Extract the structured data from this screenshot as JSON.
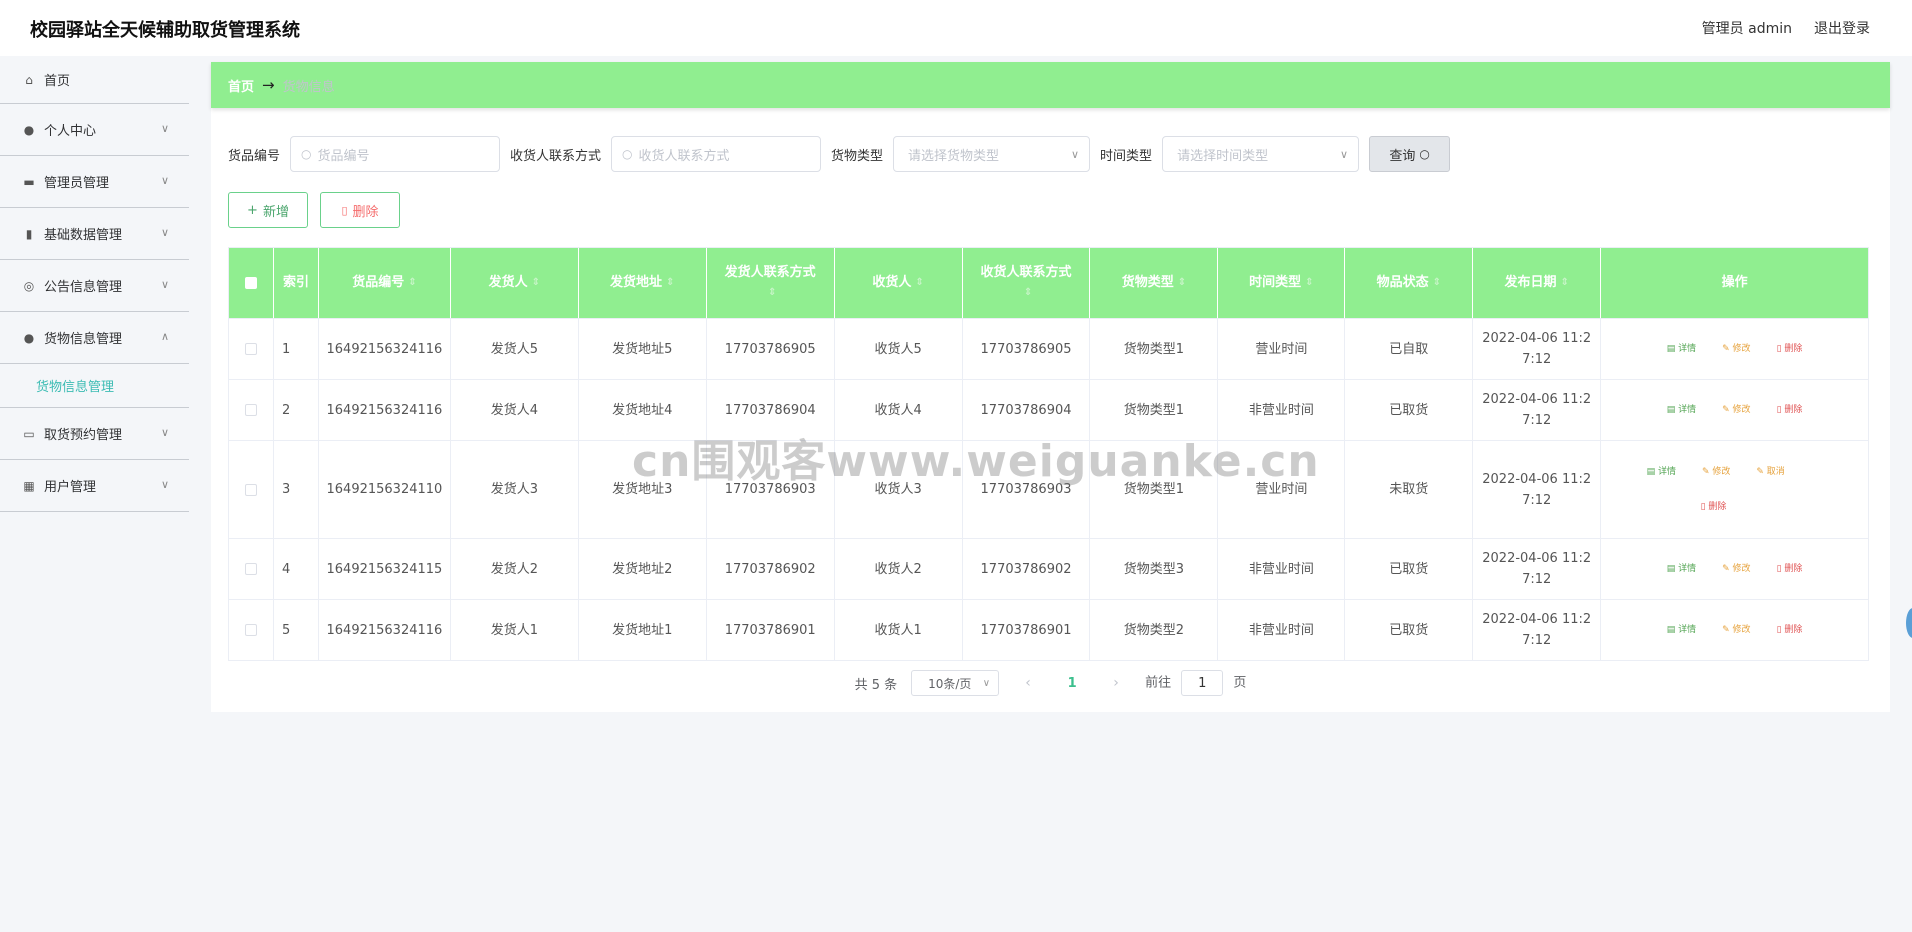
{
  "header": {
    "title": "校园驿站全天候辅助取货管理系统",
    "user": "管理员 admin",
    "logout": "退出登录"
  },
  "sidebar": {
    "items": [
      {
        "label": "首页",
        "icon": "home-icon"
      },
      {
        "label": "个人中心",
        "icon": "person-icon"
      },
      {
        "label": "管理员管理",
        "icon": "video-icon"
      },
      {
        "label": "基础数据管理",
        "icon": "bar-chart-icon"
      },
      {
        "label": "公告信息管理",
        "icon": "compass-icon"
      },
      {
        "label": "货物信息管理",
        "icon": "user-icon"
      },
      {
        "label": "取货预约管理",
        "icon": "monitor-icon"
      },
      {
        "label": "用户管理",
        "icon": "grid-icon"
      }
    ],
    "submenu_active": "货物信息管理"
  },
  "breadcrumb": {
    "home": "首页",
    "current": "货物信息"
  },
  "filters": {
    "goods_no_label": "货品编号",
    "goods_no_placeholder": "货品编号",
    "receiver_contact_label": "收货人联系方式",
    "receiver_contact_placeholder": "收货人联系方式",
    "goods_type_label": "货物类型",
    "goods_type_placeholder": "请选择货物类型",
    "time_type_label": "时间类型",
    "time_type_placeholder": "请选择时间类型",
    "query_button": "查询"
  },
  "actions": {
    "add": "新增",
    "delete": "删除"
  },
  "table": {
    "columns": [
      "索引",
      "货品编号",
      "发货人",
      "发货地址",
      "发货人联系方式",
      "收货人",
      "收货人联系方式",
      "货物类型",
      "时间类型",
      "物品状态",
      "发布日期",
      "操作"
    ],
    "rows": [
      {
        "index": "1",
        "goods_no": "16492156324116",
        "sender": "发货人5",
        "address": "发货地址5",
        "sender_phone": "17703786905",
        "receiver": "收货人5",
        "receiver_phone": "17703786905",
        "goods_type": "货物类型1",
        "time_type": "营业时间",
        "status": "已自取",
        "date_line1": "2022-04-06 11:2",
        "date_line2": "7:12"
      },
      {
        "index": "2",
        "goods_no": "16492156324116",
        "sender": "发货人4",
        "address": "发货地址4",
        "sender_phone": "17703786904",
        "receiver": "收货人4",
        "receiver_phone": "17703786904",
        "goods_type": "货物类型1",
        "time_type": "非营业时间",
        "status": "已取货",
        "date_line1": "2022-04-06 11:2",
        "date_line2": "7:12"
      },
      {
        "index": "3",
        "goods_no": "16492156324110",
        "sender": "发货人3",
        "address": "发货地址3",
        "sender_phone": "17703786903",
        "receiver": "收货人3",
        "receiver_phone": "17703786903",
        "goods_type": "货物类型1",
        "time_type": "营业时间",
        "status": "未取货",
        "date_line1": "2022-04-06 11:2",
        "date_line2": "7:12"
      },
      {
        "index": "4",
        "goods_no": "16492156324115",
        "sender": "发货人2",
        "address": "发货地址2",
        "sender_phone": "17703786902",
        "receiver": "收货人2",
        "receiver_phone": "17703786902",
        "goods_type": "货物类型3",
        "time_type": "非营业时间",
        "status": "已取货",
        "date_line1": "2022-04-06 11:2",
        "date_line2": "7:12"
      },
      {
        "index": "5",
        "goods_no": "16492156324116",
        "sender": "发货人1",
        "address": "发货地址1",
        "sender_phone": "17703786901",
        "receiver": "收货人1",
        "receiver_phone": "17703786901",
        "goods_type": "货物类型2",
        "time_type": "非营业时间",
        "status": "已取货",
        "date_line1": "2022-04-06 11:2",
        "date_line2": "7:12"
      }
    ],
    "ops": {
      "detail": "详情",
      "edit": "修改",
      "cancel": "取消",
      "delete": "删除"
    }
  },
  "pagination": {
    "total": "共 5 条",
    "page_size": "10条/页",
    "current_page": "1",
    "goto_label": "前往",
    "goto_value": "1",
    "page_unit": "页"
  },
  "watermark": "cn围观客www.weiguanke.cn"
}
